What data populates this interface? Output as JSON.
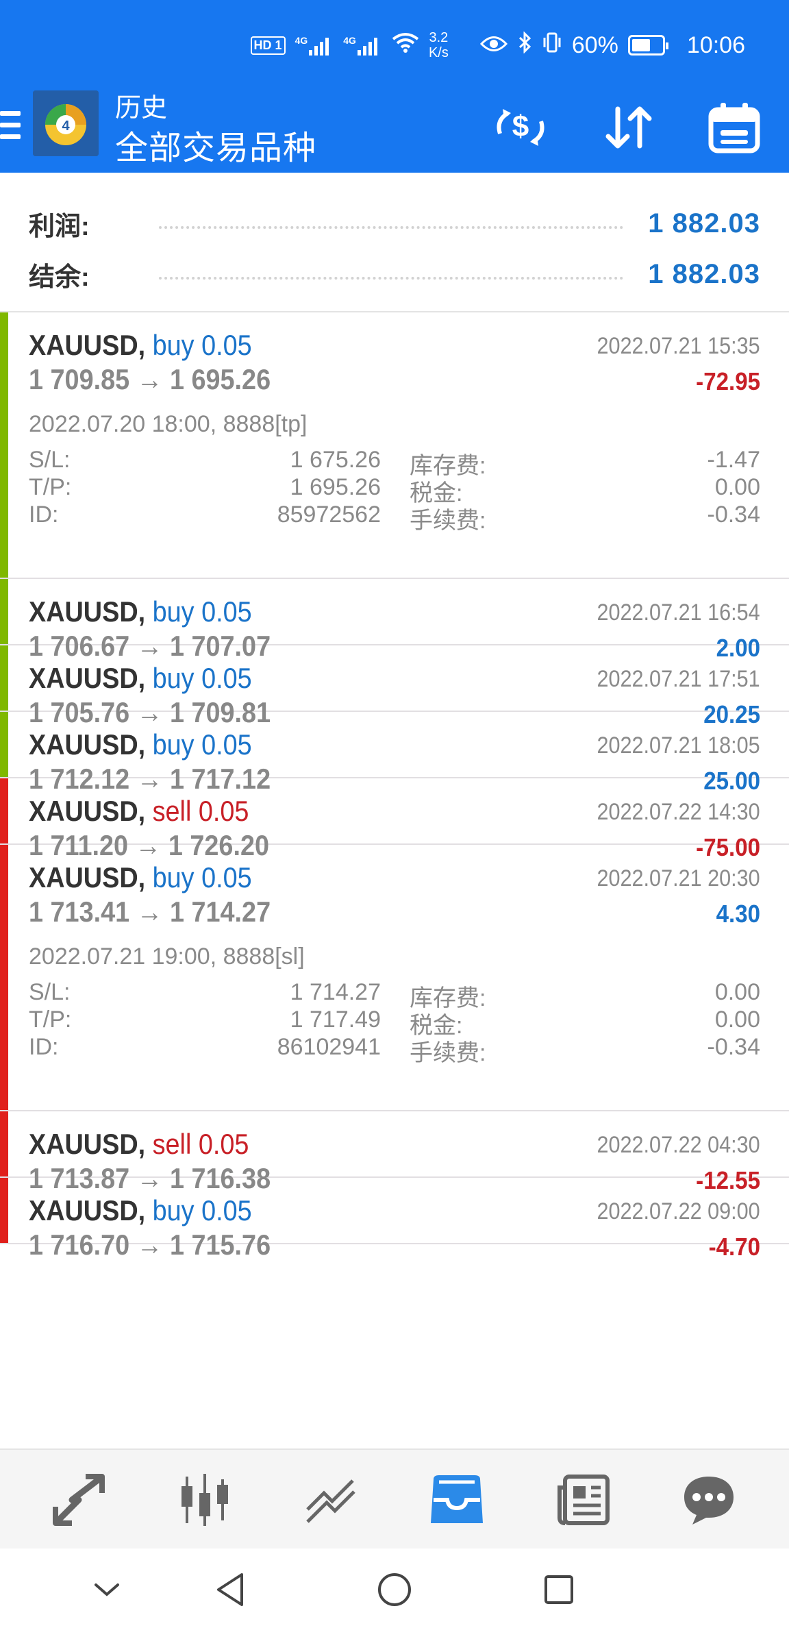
{
  "status_bar": {
    "hd": "HD",
    "sim1": "1",
    "net1": "4G",
    "net2": "4G",
    "speed_value": "3.2",
    "speed_unit": "K/s",
    "battery": "60%",
    "time": "10:06"
  },
  "app_bar": {
    "title": "历史",
    "subtitle": "全部交易品种",
    "icons": [
      "menu-icon",
      "mt4-logo",
      "currency-swap-icon",
      "sort-icon",
      "calendar-icon"
    ]
  },
  "summary": {
    "profit_label": "利润:",
    "profit_value": "1 882.03",
    "balance_label": "结余:",
    "balance_value": "1 882.03"
  },
  "trades": [
    {
      "symbol": "XAUUSD,",
      "direction": "buy 0.05",
      "dir_color": "#1a73c9",
      "bar_color": "#7fb800",
      "open_price": "1 709.85",
      "arrow": "→",
      "close_price": "1 695.26",
      "close_time": "2022.07.21 15:35",
      "profit": "-72.95",
      "profit_color": "#c82027",
      "expanded": true,
      "open_info": "2022.07.20 18:00, 8888[tp]",
      "sl_label": "S/L:",
      "sl": "1 675.26",
      "swap_label": "库存费:",
      "swap": "-1.47",
      "tp_label": "T/P:",
      "tp": "1 695.26",
      "tax_label": "税金:",
      "tax": "0.00",
      "id_label": "ID:",
      "id": "85972562",
      "fee_label": "手续费:",
      "fee": "-0.34"
    },
    {
      "symbol": "XAUUSD,",
      "direction": "buy 0.05",
      "dir_color": "#1a73c9",
      "bar_color": "#7fb800",
      "open_price": "1 706.67",
      "arrow": "→",
      "close_price": "1 707.07",
      "close_time": "2022.07.21 16:54",
      "profit": "2.00",
      "profit_color": "#1a73c9",
      "expanded": false
    },
    {
      "symbol": "XAUUSD,",
      "direction": "buy 0.05",
      "dir_color": "#1a73c9",
      "bar_color": "#7fb800",
      "open_price": "1 705.76",
      "arrow": "→",
      "close_price": "1 709.81",
      "close_time": "2022.07.21 17:51",
      "profit": "20.25",
      "profit_color": "#1a73c9",
      "expanded": false
    },
    {
      "symbol": "XAUUSD,",
      "direction": "buy 0.05",
      "dir_color": "#1a73c9",
      "bar_color": "#7fb800",
      "open_price": "1 712.12",
      "arrow": "→",
      "close_price": "1 717.12",
      "close_time": "2022.07.21 18:05",
      "profit": "25.00",
      "profit_color": "#1a73c9",
      "expanded": false
    },
    {
      "symbol": "XAUUSD,",
      "direction": "sell 0.05",
      "dir_color": "#c82027",
      "bar_color": "#e0201b",
      "open_price": "1 711.20",
      "arrow": "→",
      "close_price": "1 726.20",
      "close_time": "2022.07.22 14:30",
      "profit": "-75.00",
      "profit_color": "#c82027",
      "expanded": false
    },
    {
      "symbol": "XAUUSD,",
      "direction": "buy 0.05",
      "dir_color": "#1a73c9",
      "bar_color": "#e0201b",
      "open_price": "1 713.41",
      "arrow": "→",
      "close_price": "1 714.27",
      "close_time": "2022.07.21 20:30",
      "profit": "4.30",
      "profit_color": "#1a73c9",
      "expanded": true,
      "open_info": "2022.07.21 19:00, 8888[sl]",
      "sl_label": "S/L:",
      "sl": "1 714.27",
      "swap_label": "库存费:",
      "swap": "0.00",
      "tp_label": "T/P:",
      "tp": "1 717.49",
      "tax_label": "税金:",
      "tax": "0.00",
      "id_label": "ID:",
      "id": "86102941",
      "fee_label": "手续费:",
      "fee": "-0.34"
    },
    {
      "symbol": "XAUUSD,",
      "direction": "sell 0.05",
      "dir_color": "#c82027",
      "bar_color": "#e0201b",
      "open_price": "1 713.87",
      "arrow": "→",
      "close_price": "1 716.38",
      "close_time": "2022.07.22 04:30",
      "profit": "-12.55",
      "profit_color": "#c82027",
      "expanded": false
    },
    {
      "symbol": "XAUUSD,",
      "direction": "buy 0.05",
      "dir_color": "#1a73c9",
      "bar_color": "#e0201b",
      "open_price": "1 716.70",
      "arrow": "→",
      "close_price": "1 715.76",
      "close_time": "2022.07.22 09:00",
      "profit": "-4.70",
      "profit_color": "#c82027",
      "expanded": false
    }
  ],
  "bottom_nav": {
    "items": [
      "quotes-icon",
      "chart-icon",
      "trade-icon",
      "history-icon",
      "news-icon",
      "chat-icon"
    ],
    "active": "history-icon",
    "active_color": "#2b8ae8"
  },
  "system_nav": {
    "items": [
      "collapse-icon",
      "back-icon",
      "home-icon",
      "recents-icon"
    ]
  }
}
